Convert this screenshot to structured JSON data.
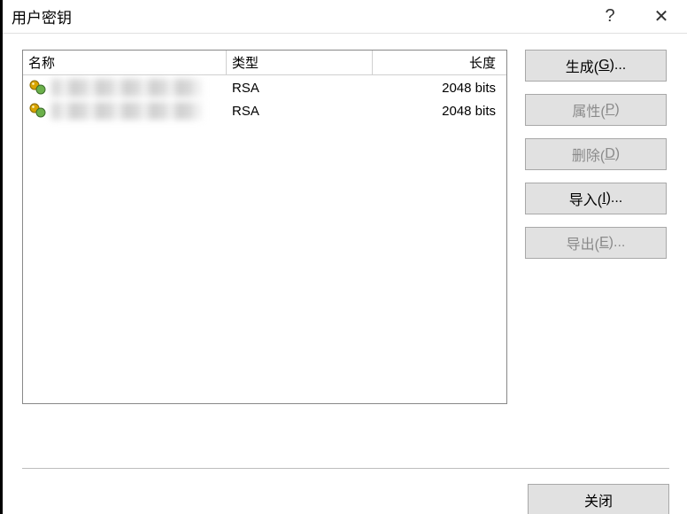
{
  "window": {
    "title": "用户密钥",
    "help_glyph": "?",
    "close_glyph": "✕"
  },
  "columns": {
    "name": "名称",
    "type": "类型",
    "length": "长度"
  },
  "rows": [
    {
      "type": "RSA",
      "length": "2048 bits"
    },
    {
      "type": "RSA",
      "length": "2048 bits"
    }
  ],
  "buttons": {
    "generate_pre": "生成(",
    "generate_u": "G",
    "generate_post": ")...",
    "properties_pre": "属性(",
    "properties_u": "P",
    "properties_post": ")",
    "delete_pre": "删除(",
    "delete_u": "D",
    "delete_post": ")",
    "import_pre": "导入(",
    "import_u": "I",
    "import_post": ")...",
    "export_pre": "导出(",
    "export_u": "E",
    "export_post": ")...",
    "close": "关闭"
  }
}
